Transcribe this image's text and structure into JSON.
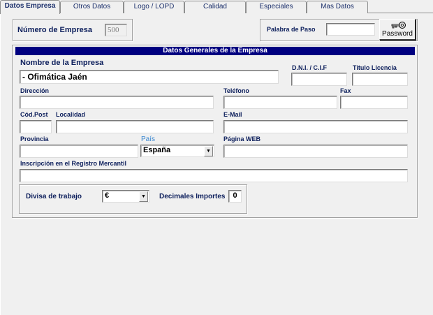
{
  "tabs": [
    {
      "label": "Datos Empresa",
      "active": true
    },
    {
      "label": "Otros Datos",
      "active": false
    },
    {
      "label": "Logo / LOPD",
      "active": false
    },
    {
      "label": "Calidad",
      "active": false
    },
    {
      "label": "Especiales",
      "active": false
    },
    {
      "label": "Mas Datos",
      "active": false
    }
  ],
  "empresa": {
    "numero_label": "Número de Empresa",
    "numero_value": "500"
  },
  "password": {
    "palabra_label": "Palabra de Paso",
    "palabra_value": "",
    "button_label": "Password",
    "icon": "key-icon"
  },
  "section": {
    "title": "Datos Generales de la Empresa"
  },
  "form": {
    "nombre_label": "Nombre de la Empresa",
    "nombre_value": "- Ofimática Jaén",
    "dni_label": "D.N.I. / C.I.F",
    "dni_value": "",
    "titulo_label": "Titulo Licencia",
    "titulo_value": "",
    "direccion_label": "Dirección",
    "direccion_value": "",
    "telefono_label": "Teléfono",
    "telefono_value": "",
    "fax_label": "Fax",
    "fax_value": "",
    "codpost_label": "Cód.Post",
    "codpost_value": "",
    "localidad_label": "Localidad",
    "localidad_value": "",
    "email_label": "E-Mail",
    "email_value": "",
    "provincia_label": "Provincia",
    "provincia_value": "",
    "pais_label": "País",
    "pais_value": "España",
    "web_label": "Página WEB",
    "web_value": "",
    "registro_label": "Inscripción en el Registro Mercantil",
    "registro_value": ""
  },
  "divisa": {
    "label": "Divisa de trabajo",
    "value": "€",
    "decimales_label": "Decimales Importes",
    "decimales_value": "0"
  },
  "colors": {
    "header_bg": "#000080",
    "label_color": "#0d1f5c",
    "pais_label_color": "#3a87d0"
  }
}
